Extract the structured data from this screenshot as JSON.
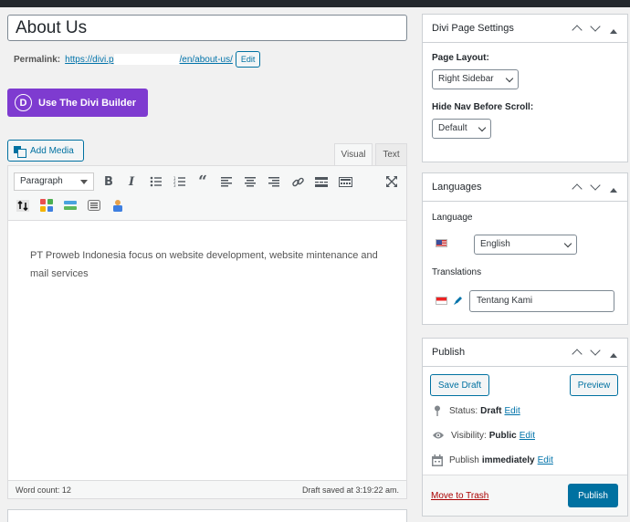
{
  "title": {
    "value": "About Us"
  },
  "permalink": {
    "label": "Permalink:",
    "url_start": "https://divi.p",
    "url_end": "/en/about-us/",
    "edit_label": "Edit"
  },
  "divi": {
    "button_label": "Use The Divi Builder",
    "logo_letter": "D"
  },
  "editor": {
    "add_media_label": "Add Media",
    "tabs": {
      "visual": "Visual",
      "text": "Text"
    },
    "format_select": "Paragraph",
    "content": "PT Proweb Indonesia focus on website development, website mintenance and mail services",
    "word_count": "Word count: 12",
    "draft_saved": "Draft saved at 3:19:22 am."
  },
  "page_settings": {
    "title": "Divi Page Settings",
    "layout_label": "Page Layout:",
    "layout_value": "Right Sidebar",
    "hide_nav_label": "Hide Nav Before Scroll:",
    "hide_nav_value": "Default"
  },
  "languages": {
    "title": "Languages",
    "language_label": "Language",
    "language_value": "English",
    "translations_label": "Translations",
    "translation_value": "Tentang Kami"
  },
  "publish": {
    "title": "Publish",
    "save_draft": "Save Draft",
    "preview": "Preview",
    "status_label": "Status:",
    "status_value": "Draft",
    "visibility_label": "Visibility:",
    "visibility_value": "Public",
    "publish_label": "Publish",
    "publish_value": "immediately",
    "edit_label": "Edit",
    "move_to_trash": "Move to Trash",
    "publish_button": "Publish"
  },
  "colors": {
    "accent": "#0071a1",
    "divi": "#7e3bd0",
    "trash": "#a00000"
  }
}
